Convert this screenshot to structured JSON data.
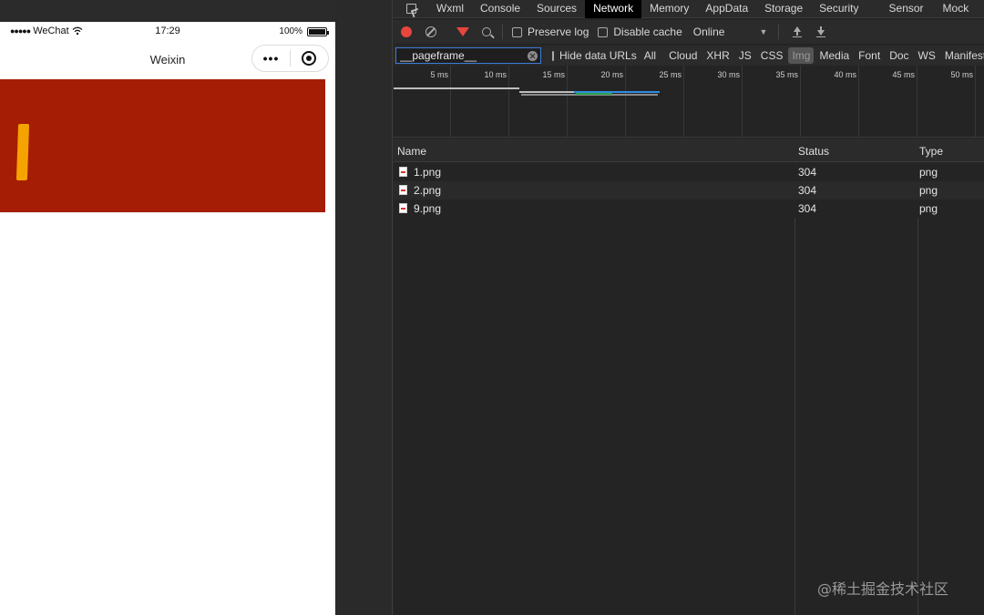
{
  "simulator": {
    "status": {
      "signal": "●●●●●",
      "carrier": "WeChat",
      "time": "17:29",
      "battery_pct": "100%"
    },
    "nav_title": "Weixin",
    "capsule_more": "•••",
    "banner_color": "#a51d04",
    "accent_color": "#f5a300"
  },
  "devtools": {
    "tabs": [
      "Wxml",
      "Console",
      "Sources",
      "Network",
      "Memory",
      "AppData",
      "Storage",
      "Security",
      "Sensor",
      "Mock"
    ],
    "active_tab": "Network",
    "toolbar": {
      "preserve_log": "Preserve log",
      "disable_cache": "Disable cache",
      "throttle": "Online"
    },
    "filter": {
      "value": "__pageframe__",
      "hide_data_urls": "Hide data URLs",
      "types": [
        "All",
        "Cloud",
        "XHR",
        "JS",
        "CSS",
        "Img",
        "Media",
        "Font",
        "Doc",
        "WS",
        "Manifest"
      ],
      "active_type": "Img"
    },
    "timeline": {
      "ticks": [
        "5 ms",
        "10 ms",
        "15 ms",
        "20 ms",
        "25 ms",
        "30 ms",
        "35 ms",
        "40 ms",
        "45 ms",
        "50 ms"
      ]
    },
    "table": {
      "headers": {
        "name": "Name",
        "status": "Status",
        "type": "Type"
      },
      "rows": [
        {
          "name": "1.png",
          "status": "304",
          "type": "png"
        },
        {
          "name": "2.png",
          "status": "304",
          "type": "png"
        },
        {
          "name": "9.png",
          "status": "304",
          "type": "png"
        }
      ]
    }
  },
  "watermark": "@稀土掘金技术社区"
}
